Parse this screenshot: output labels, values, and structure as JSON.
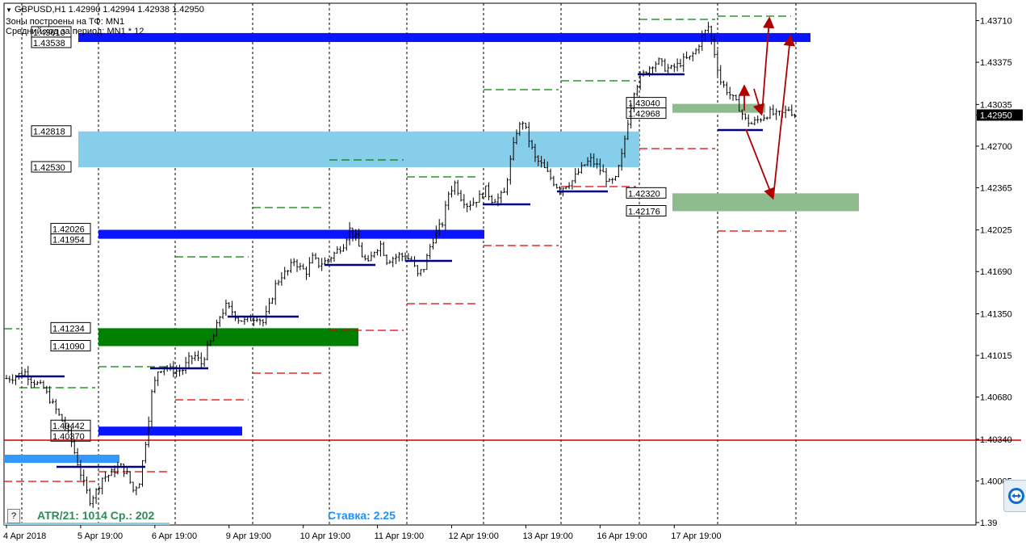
{
  "header": {
    "symbol_line": "GBPUSD,H1  1.42990 1.42994 1.42938 1.42950",
    "zones_line": "Зоны построены на ТФ: MN1",
    "avg_line": "Средний ход за период: MN1 * 12"
  },
  "footer": {
    "atr_text": "ATR/21: 1014  Ср.: 202",
    "stake_text": "Ставка: 2.25",
    "help_label": "?"
  },
  "colors": {
    "candles": "#000000",
    "bid_line": "#cc0000",
    "zone_blue": "#0a14ff",
    "zone_lightblue": "#87ceeb",
    "zone_green": "#008000",
    "zone_lightgreen": "#8fbc8f",
    "arrows": "#b00000",
    "stake_text": "#1e90ff",
    "atr_text": "#2e8b57"
  },
  "chart_data": {
    "type": "candlestick",
    "symbol": "GBPUSD",
    "timeframe": "H1",
    "ylim": [
      1.3965,
      1.4385
    ],
    "grid": "vertical dashed session separators",
    "current_price": 1.4295,
    "x_tick_labels": [
      "4 Apr 2018",
      "5 Apr 19:00",
      "6 Apr 19:00",
      "9 Apr 19:00",
      "10 Apr 19:00",
      "11 Apr 19:00",
      "12 Apr 19:00",
      "13 Apr 19:00",
      "16 Apr 19:00",
      "17 Apr 19:00"
    ],
    "y_tick_labels": [
      "1.43710",
      "1.43375",
      "1.43035",
      "1.42950",
      "1.42700",
      "1.42365",
      "1.42025",
      "1.41690",
      "1.41350",
      "1.41015",
      "1.40680",
      "1.40340",
      "1.40005",
      "1.39"
    ],
    "y_tick_values": [
      1.4371,
      1.43375,
      1.43035,
      1.4295,
      1.427,
      1.42365,
      1.42025,
      1.4169,
      1.4135,
      1.41015,
      1.4068,
      1.4034,
      1.40005,
      1.3967
    ],
    "price_path": [
      [
        0,
        1.4083
      ],
      [
        2,
        1.4084
      ],
      [
        6,
        1.4088
      ],
      [
        8,
        1.4082
      ],
      [
        12,
        1.4075
      ],
      [
        15,
        1.4062
      ],
      [
        17,
        1.4053
      ],
      [
        19,
        1.4045
      ],
      [
        21,
        1.4032
      ],
      [
        23,
        1.4015
      ],
      [
        25,
        1.3998
      ],
      [
        27,
        1.3985
      ],
      [
        29,
        1.3992
      ],
      [
        31,
        1.4003
      ],
      [
        33,
        1.4005
      ],
      [
        35,
        1.4009
      ],
      [
        37,
        1.4012
      ],
      [
        39,
        1.4006
      ],
      [
        41,
        1.3993
      ],
      [
        43,
        1.4
      ],
      [
        45,
        1.4032
      ],
      [
        47,
        1.4071
      ],
      [
        49,
        1.4089
      ],
      [
        51,
        1.4093
      ],
      [
        53,
        1.409
      ],
      [
        55,
        1.4089
      ],
      [
        57,
        1.409
      ],
      [
        59,
        1.4098
      ],
      [
        61,
        1.4101
      ],
      [
        63,
        1.4095
      ],
      [
        65,
        1.4107
      ],
      [
        67,
        1.4117
      ],
      [
        69,
        1.4133
      ],
      [
        71,
        1.4141
      ],
      [
        73,
        1.4137
      ],
      [
        75,
        1.4131
      ],
      [
        77,
        1.4129
      ],
      [
        79,
        1.4131
      ],
      [
        81,
        1.4133
      ],
      [
        83,
        1.4128
      ],
      [
        85,
        1.4141
      ],
      [
        87,
        1.4158
      ],
      [
        89,
        1.4166
      ],
      [
        91,
        1.4169
      ],
      [
        93,
        1.4178
      ],
      [
        95,
        1.4172
      ],
      [
        97,
        1.4169
      ],
      [
        99,
        1.418
      ],
      [
        101,
        1.4175
      ],
      [
        103,
        1.4177
      ],
      [
        105,
        1.4181
      ],
      [
        107,
        1.4186
      ],
      [
        109,
        1.4191
      ],
      [
        111,
        1.4203
      ],
      [
        113,
        1.4196
      ],
      [
        115,
        1.4182
      ],
      [
        117,
        1.4175
      ],
      [
        119,
        1.4186
      ],
      [
        121,
        1.4191
      ],
      [
        123,
        1.4178
      ],
      [
        125,
        1.418
      ],
      [
        127,
        1.4182
      ],
      [
        129,
        1.4181
      ],
      [
        131,
        1.4178
      ],
      [
        133,
        1.4166
      ],
      [
        135,
        1.4172
      ],
      [
        137,
        1.4189
      ],
      [
        139,
        1.4201
      ],
      [
        141,
        1.4208
      ],
      [
        143,
        1.4232
      ],
      [
        145,
        1.424
      ],
      [
        147,
        1.4229
      ],
      [
        149,
        1.4223
      ],
      [
        151,
        1.4225
      ],
      [
        153,
        1.4229
      ],
      [
        155,
        1.4235
      ],
      [
        157,
        1.4227
      ],
      [
        159,
        1.4228
      ],
      [
        161,
        1.4232
      ],
      [
        163,
        1.4258
      ],
      [
        165,
        1.4282
      ],
      [
        167,
        1.429
      ],
      [
        169,
        1.4275
      ],
      [
        171,
        1.426
      ],
      [
        173,
        1.4255
      ],
      [
        175,
        1.4248
      ],
      [
        177,
        1.4241
      ],
      [
        179,
        1.4235
      ],
      [
        181,
        1.4239
      ],
      [
        183,
        1.4242
      ],
      [
        185,
        1.4249
      ],
      [
        187,
        1.4255
      ],
      [
        189,
        1.4259
      ],
      [
        191,
        1.4254
      ],
      [
        193,
        1.4248
      ],
      [
        195,
        1.424
      ],
      [
        197,
        1.4243
      ],
      [
        199,
        1.4262
      ],
      [
        201,
        1.429
      ],
      [
        203,
        1.4315
      ],
      [
        205,
        1.4325
      ],
      [
        207,
        1.4331
      ],
      [
        209,
        1.4336
      ],
      [
        211,
        1.4338
      ],
      [
        213,
        1.4333
      ],
      [
        215,
        1.4332
      ],
      [
        217,
        1.4335
      ],
      [
        219,
        1.4339
      ],
      [
        221,
        1.4341
      ],
      [
        223,
        1.4347
      ],
      [
        225,
        1.4358
      ],
      [
        227,
        1.4366
      ],
      [
        229,
        1.4345
      ],
      [
        231,
        1.4322
      ],
      [
        233,
        1.4315
      ],
      [
        235,
        1.4308
      ],
      [
        237,
        1.4301
      ],
      [
        239,
        1.4291
      ],
      [
        241,
        1.4288
      ],
      [
        243,
        1.4291
      ],
      [
        245,
        1.4294
      ],
      [
        247,
        1.4297
      ],
      [
        249,
        1.4295
      ],
      [
        251,
        1.4296
      ],
      [
        253,
        1.43
      ],
      [
        255,
        1.4295
      ]
    ],
    "x_ticks_index": [
      0,
      24,
      48,
      72,
      96,
      120,
      144,
      168,
      192,
      216
    ],
    "zones": [
      {
        "upper": "1.43610",
        "lower": "1.43538",
        "color": "blue"
      },
      {
        "upper": "1.43040",
        "lower": "1.42968",
        "color": "lightgreen"
      },
      {
        "upper": "1.42818",
        "lower": "1.42530",
        "color": "lightblue"
      },
      {
        "upper": "1.42320",
        "lower": "1.42176",
        "color": "lightgreen"
      },
      {
        "upper": "1.42026",
        "lower": "1.41954",
        "color": "blue"
      },
      {
        "upper": "1.41234",
        "lower": "1.41090",
        "color": "green"
      },
      {
        "upper": "1.40442",
        "lower": "1.40370",
        "color": "blue"
      }
    ]
  }
}
